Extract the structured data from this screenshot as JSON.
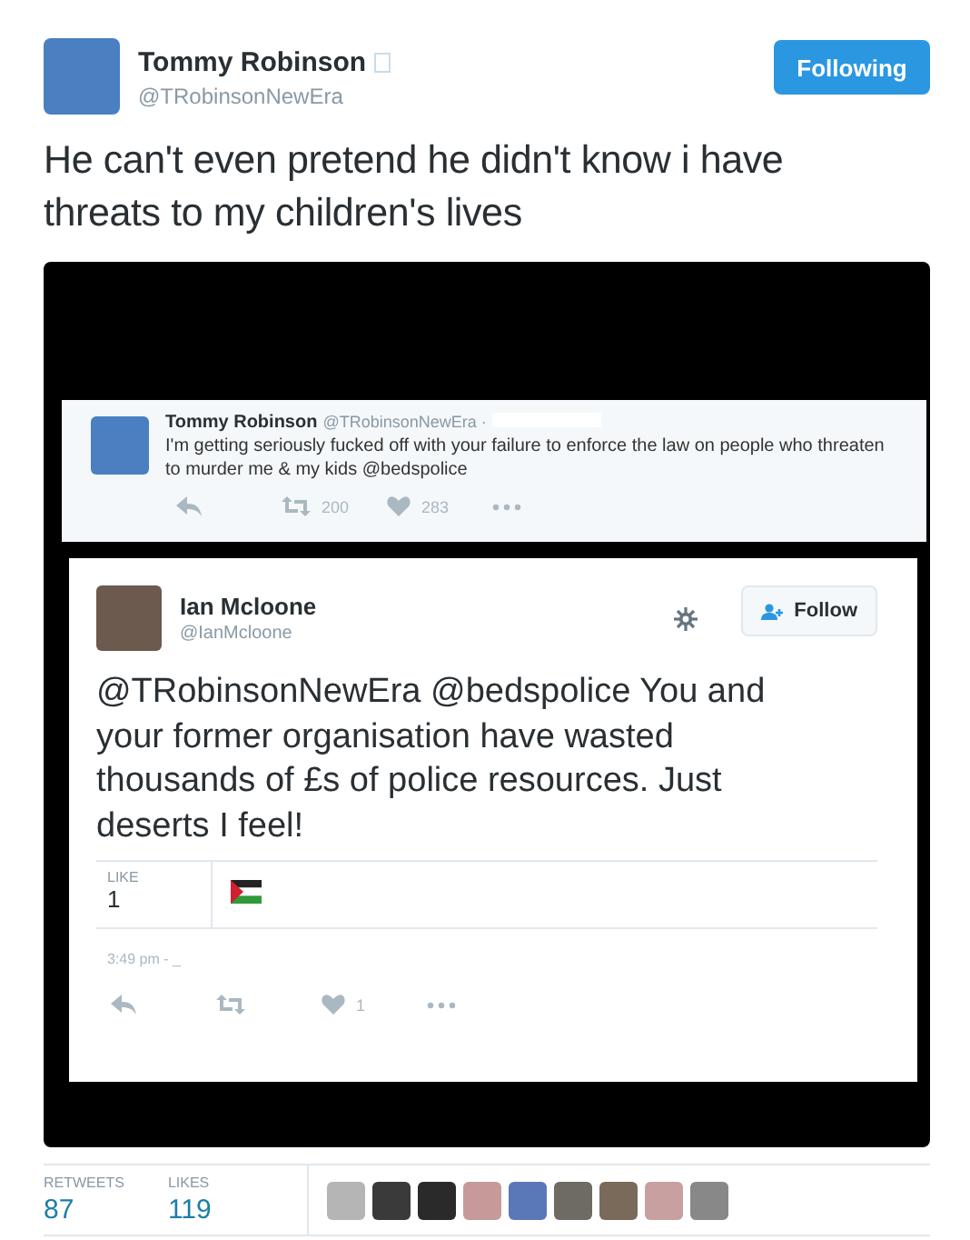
{
  "tweet": {
    "author": {
      "name": "Tommy Robinson",
      "handle": "@TRobinsonNewEra"
    },
    "follow_button": {
      "label": "Following",
      "selected": true
    },
    "text": "He can't even pretend he didn't know i have threats to my children's lives"
  },
  "screenshot": {
    "quoted_tweet": {
      "name": "Tommy Robinson",
      "handle": "@TRobinsonNewEra ·",
      "text": "I'm getting seriously fucked off with your failure to enforce the law on people who threaten to murder me & my kids @bedspolice",
      "retweets": "200",
      "likes": "283"
    },
    "reply_tweet": {
      "name": "Ian Mcloone",
      "handle": "@IanMcloone",
      "follow_label": "Follow",
      "text": "@TRobinsonNewEra @bedspolice  You and your former organisation have wasted thousands of £s of police resources. Just deserts I feel!",
      "like_label": "LIKE",
      "like_count": "1",
      "time": "3:49 pm - _",
      "likes": "1"
    }
  },
  "stats": [
    {
      "label": "RETWEETS",
      "value": "87"
    },
    {
      "label": "LIKES",
      "value": "119"
    }
  ]
}
